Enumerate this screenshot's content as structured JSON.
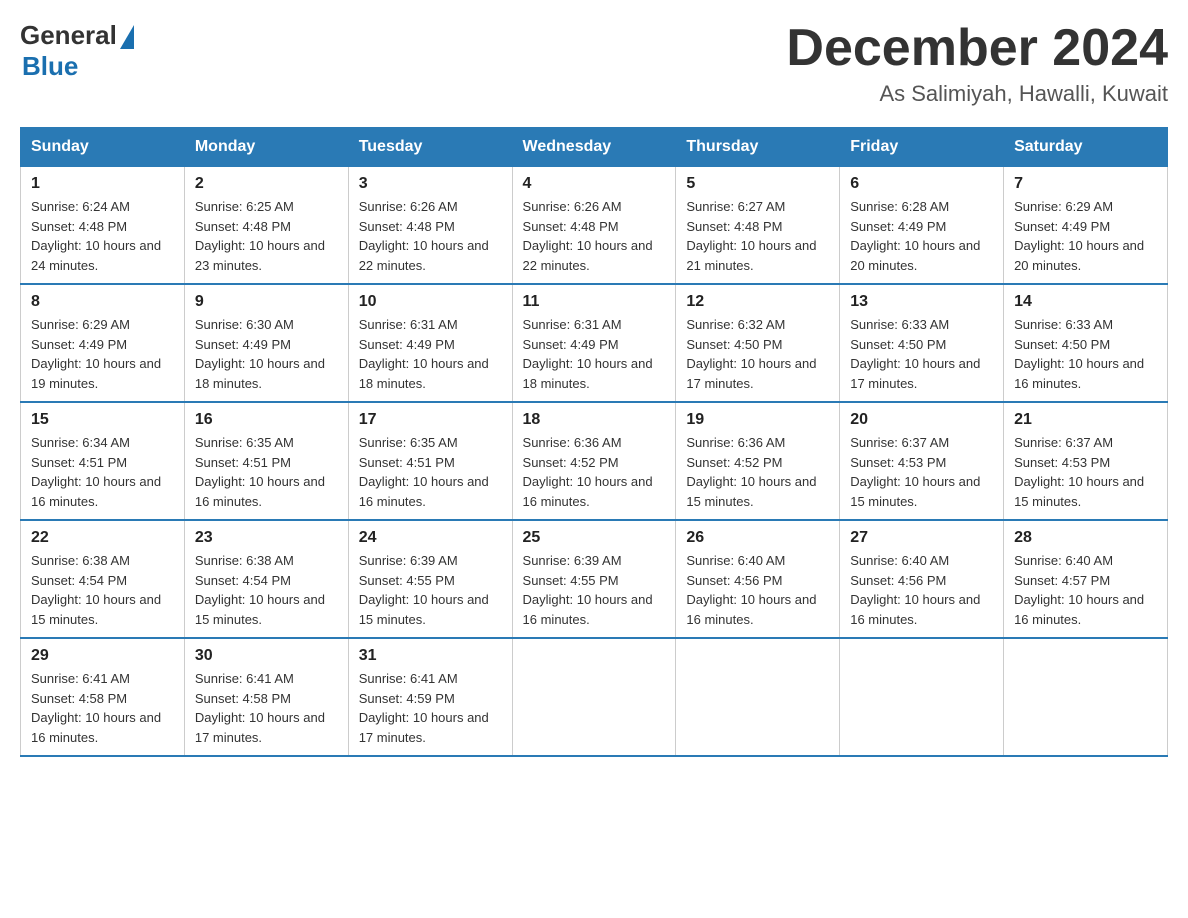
{
  "header": {
    "logo_general": "General",
    "logo_blue": "Blue",
    "month_title": "December 2024",
    "location": "As Salimiyah, Hawalli, Kuwait"
  },
  "weekdays": [
    "Sunday",
    "Monday",
    "Tuesday",
    "Wednesday",
    "Thursday",
    "Friday",
    "Saturday"
  ],
  "weeks": [
    [
      {
        "day": "1",
        "sunrise": "6:24 AM",
        "sunset": "4:48 PM",
        "daylight": "10 hours and 24 minutes."
      },
      {
        "day": "2",
        "sunrise": "6:25 AM",
        "sunset": "4:48 PM",
        "daylight": "10 hours and 23 minutes."
      },
      {
        "day": "3",
        "sunrise": "6:26 AM",
        "sunset": "4:48 PM",
        "daylight": "10 hours and 22 minutes."
      },
      {
        "day": "4",
        "sunrise": "6:26 AM",
        "sunset": "4:48 PM",
        "daylight": "10 hours and 22 minutes."
      },
      {
        "day": "5",
        "sunrise": "6:27 AM",
        "sunset": "4:48 PM",
        "daylight": "10 hours and 21 minutes."
      },
      {
        "day": "6",
        "sunrise": "6:28 AM",
        "sunset": "4:49 PM",
        "daylight": "10 hours and 20 minutes."
      },
      {
        "day": "7",
        "sunrise": "6:29 AM",
        "sunset": "4:49 PM",
        "daylight": "10 hours and 20 minutes."
      }
    ],
    [
      {
        "day": "8",
        "sunrise": "6:29 AM",
        "sunset": "4:49 PM",
        "daylight": "10 hours and 19 minutes."
      },
      {
        "day": "9",
        "sunrise": "6:30 AM",
        "sunset": "4:49 PM",
        "daylight": "10 hours and 18 minutes."
      },
      {
        "day": "10",
        "sunrise": "6:31 AM",
        "sunset": "4:49 PM",
        "daylight": "10 hours and 18 minutes."
      },
      {
        "day": "11",
        "sunrise": "6:31 AM",
        "sunset": "4:49 PM",
        "daylight": "10 hours and 18 minutes."
      },
      {
        "day": "12",
        "sunrise": "6:32 AM",
        "sunset": "4:50 PM",
        "daylight": "10 hours and 17 minutes."
      },
      {
        "day": "13",
        "sunrise": "6:33 AM",
        "sunset": "4:50 PM",
        "daylight": "10 hours and 17 minutes."
      },
      {
        "day": "14",
        "sunrise": "6:33 AM",
        "sunset": "4:50 PM",
        "daylight": "10 hours and 16 minutes."
      }
    ],
    [
      {
        "day": "15",
        "sunrise": "6:34 AM",
        "sunset": "4:51 PM",
        "daylight": "10 hours and 16 minutes."
      },
      {
        "day": "16",
        "sunrise": "6:35 AM",
        "sunset": "4:51 PM",
        "daylight": "10 hours and 16 minutes."
      },
      {
        "day": "17",
        "sunrise": "6:35 AM",
        "sunset": "4:51 PM",
        "daylight": "10 hours and 16 minutes."
      },
      {
        "day": "18",
        "sunrise": "6:36 AM",
        "sunset": "4:52 PM",
        "daylight": "10 hours and 16 minutes."
      },
      {
        "day": "19",
        "sunrise": "6:36 AM",
        "sunset": "4:52 PM",
        "daylight": "10 hours and 15 minutes."
      },
      {
        "day": "20",
        "sunrise": "6:37 AM",
        "sunset": "4:53 PM",
        "daylight": "10 hours and 15 minutes."
      },
      {
        "day": "21",
        "sunrise": "6:37 AM",
        "sunset": "4:53 PM",
        "daylight": "10 hours and 15 minutes."
      }
    ],
    [
      {
        "day": "22",
        "sunrise": "6:38 AM",
        "sunset": "4:54 PM",
        "daylight": "10 hours and 15 minutes."
      },
      {
        "day": "23",
        "sunrise": "6:38 AM",
        "sunset": "4:54 PM",
        "daylight": "10 hours and 15 minutes."
      },
      {
        "day": "24",
        "sunrise": "6:39 AM",
        "sunset": "4:55 PM",
        "daylight": "10 hours and 15 minutes."
      },
      {
        "day": "25",
        "sunrise": "6:39 AM",
        "sunset": "4:55 PM",
        "daylight": "10 hours and 16 minutes."
      },
      {
        "day": "26",
        "sunrise": "6:40 AM",
        "sunset": "4:56 PM",
        "daylight": "10 hours and 16 minutes."
      },
      {
        "day": "27",
        "sunrise": "6:40 AM",
        "sunset": "4:56 PM",
        "daylight": "10 hours and 16 minutes."
      },
      {
        "day": "28",
        "sunrise": "6:40 AM",
        "sunset": "4:57 PM",
        "daylight": "10 hours and 16 minutes."
      }
    ],
    [
      {
        "day": "29",
        "sunrise": "6:41 AM",
        "sunset": "4:58 PM",
        "daylight": "10 hours and 16 minutes."
      },
      {
        "day": "30",
        "sunrise": "6:41 AM",
        "sunset": "4:58 PM",
        "daylight": "10 hours and 17 minutes."
      },
      {
        "day": "31",
        "sunrise": "6:41 AM",
        "sunset": "4:59 PM",
        "daylight": "10 hours and 17 minutes."
      },
      null,
      null,
      null,
      null
    ]
  ]
}
